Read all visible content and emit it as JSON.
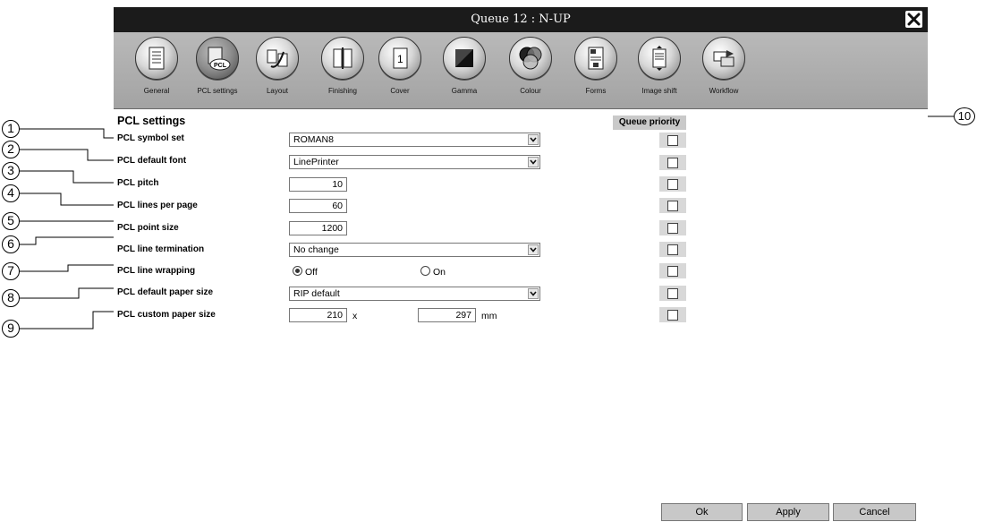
{
  "window": {
    "title": "Queue 12 : N-UP"
  },
  "toolbar": [
    {
      "label": "General",
      "icon": "general-document-icon"
    },
    {
      "label": "PCL settings",
      "icon": "pcl-settings-icon",
      "selected": true
    },
    {
      "label": "Layout",
      "icon": "layout-icon"
    },
    {
      "label": "Finishing",
      "icon": "finishing-icon"
    },
    {
      "label": "Cover",
      "icon": "cover-icon"
    },
    {
      "label": "Gamma",
      "icon": "gamma-icon"
    },
    {
      "label": "Colour",
      "icon": "colour-icon"
    },
    {
      "label": "Forms",
      "icon": "forms-icon"
    },
    {
      "label": "Image shift",
      "icon": "image-shift-icon"
    },
    {
      "label": "Workflow",
      "icon": "workflow-icon"
    }
  ],
  "panel": {
    "heading": "PCL settings",
    "queue_priority": "Queue priority",
    "rows": [
      {
        "label": "PCL symbol set",
        "value": "ROMAN8"
      },
      {
        "label": "PCL default font",
        "value": "LinePrinter"
      },
      {
        "label": "PCL pitch",
        "value": "10"
      },
      {
        "label": "PCL lines per page",
        "value": "60"
      },
      {
        "label": "PCL point size",
        "value": "1200"
      },
      {
        "label": "PCL line termination",
        "value": "No change"
      },
      {
        "label": "PCL line wrapping",
        "options": [
          "Off",
          "On"
        ],
        "selected": "Off"
      },
      {
        "label": "PCL default paper size",
        "value": "RIP default"
      },
      {
        "label": "PCL custom paper size",
        "width": "210",
        "sep": "x",
        "height": "297",
        "unit": "mm"
      }
    ]
  },
  "buttons": {
    "ok": "Ok",
    "apply": "Apply",
    "cancel": "Cancel"
  },
  "callouts": [
    "1",
    "2",
    "3",
    "4",
    "5",
    "6",
    "7",
    "8",
    "9",
    "10"
  ]
}
